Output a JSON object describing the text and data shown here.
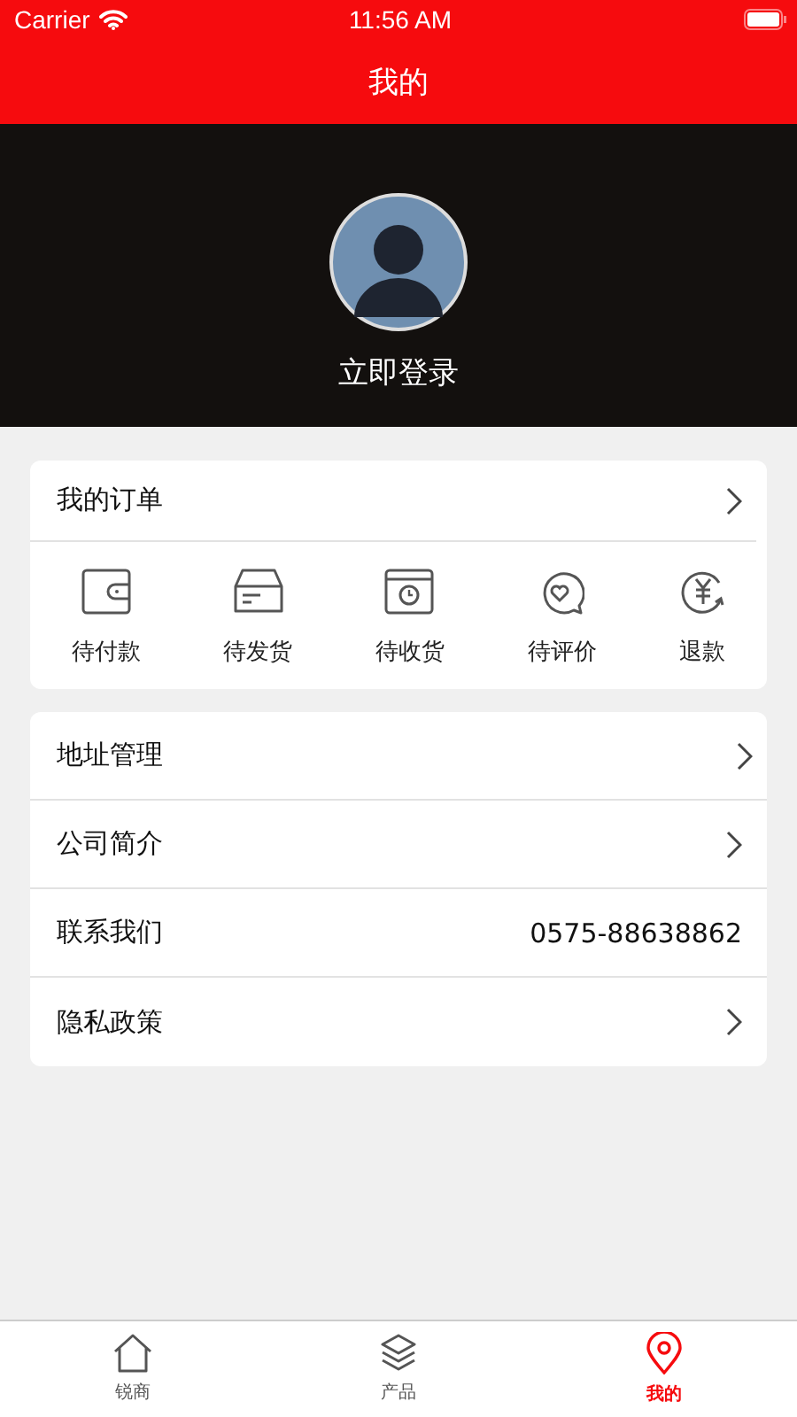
{
  "status_bar": {
    "carrier": "Carrier",
    "time": "11:56 AM"
  },
  "nav": {
    "title": "我的"
  },
  "profile": {
    "login": "立即登录"
  },
  "orders": {
    "title": "我的订单",
    "items": [
      {
        "label": "待付款"
      },
      {
        "label": "待发货"
      },
      {
        "label": "待收货"
      },
      {
        "label": "待评价"
      },
      {
        "label": "退款"
      }
    ]
  },
  "menu": [
    {
      "kind": "link",
      "label": "地址管理"
    },
    {
      "kind": "link",
      "label": "公司简介"
    },
    {
      "kind": "value",
      "label": "联系我们",
      "value": "0575-88638862"
    },
    {
      "kind": "link",
      "label": "隐私政策"
    }
  ],
  "tabs": [
    {
      "label": "锐商",
      "selected": false
    },
    {
      "label": "产品",
      "selected": false
    },
    {
      "label": "我的",
      "selected": true
    }
  ]
}
